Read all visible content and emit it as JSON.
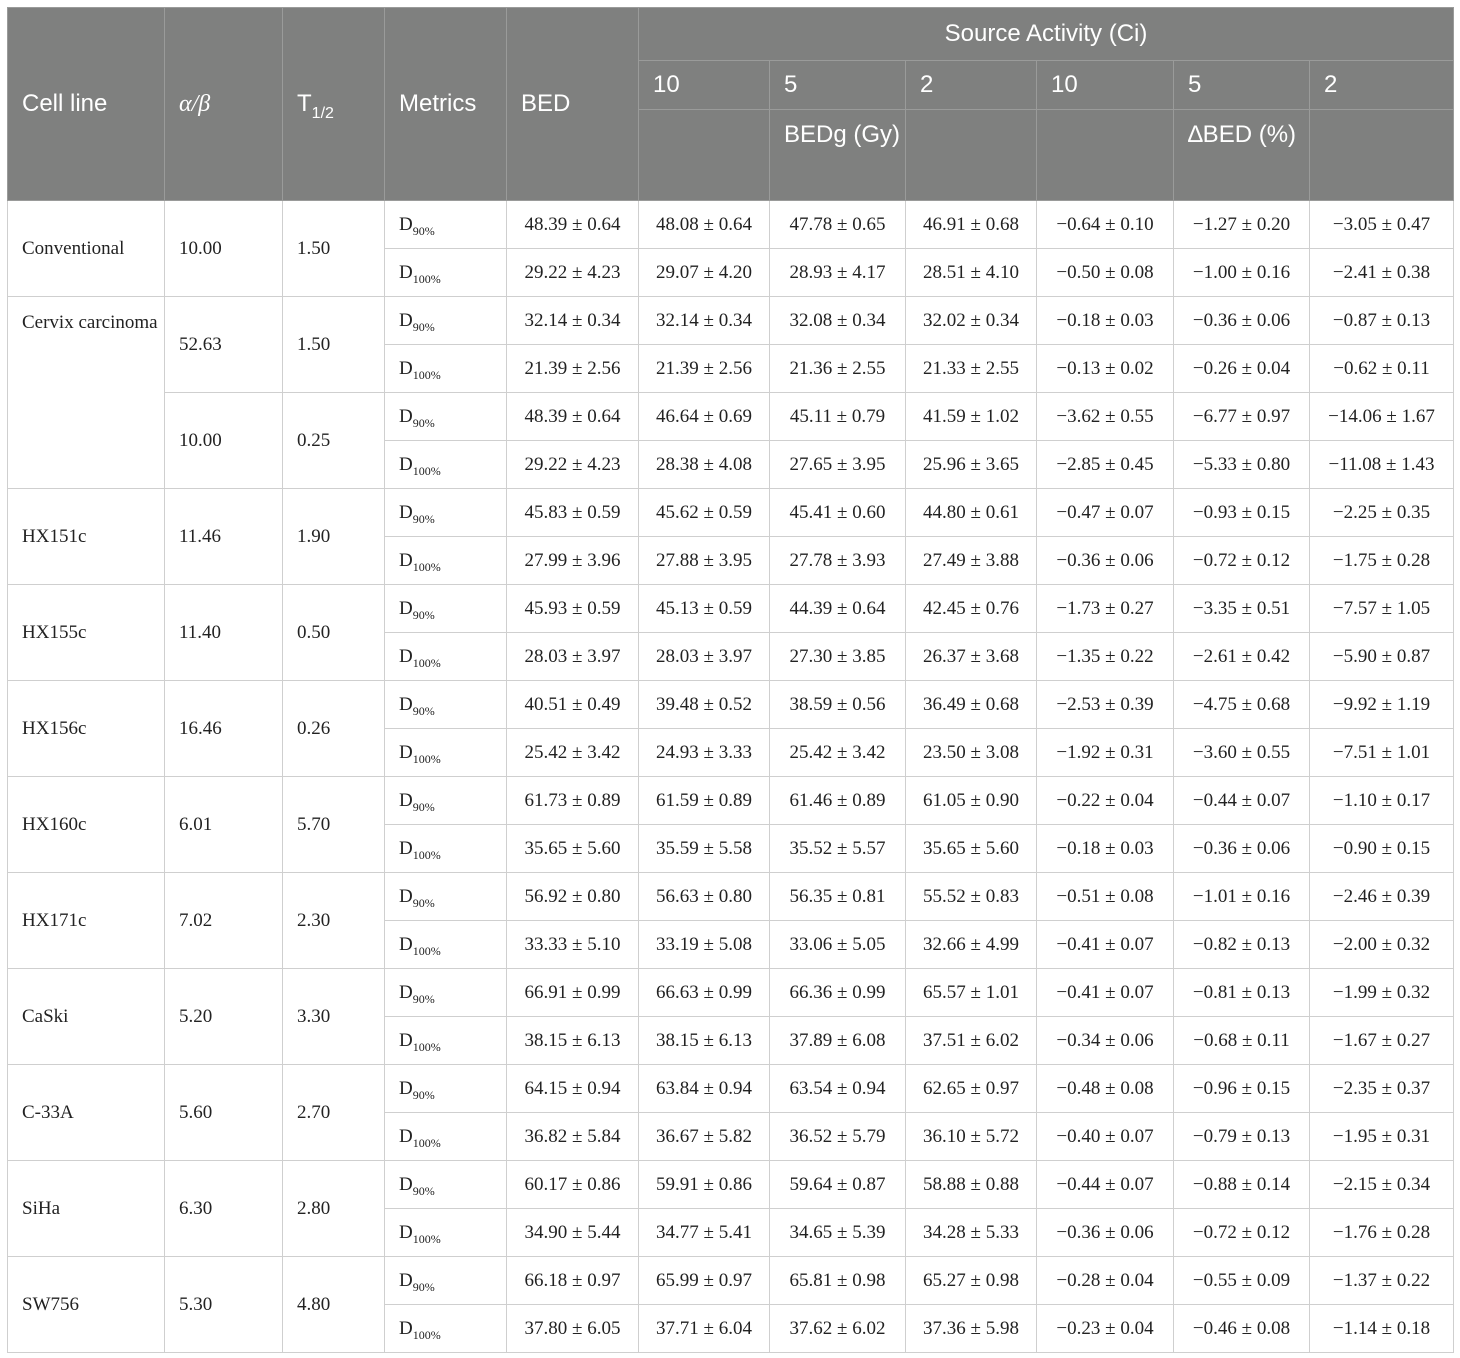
{
  "header": {
    "cell_line": "Cell line",
    "alpha_beta": "α/β",
    "t_half_main": "T",
    "t_half_sub": "1/2",
    "metrics": "Metrics",
    "bed": "BED",
    "source_activity": "Source Activity (Ci)",
    "activities": [
      "10",
      "5",
      "2",
      "10",
      "5",
      "2"
    ],
    "bedg": "BEDg (Gy)",
    "delta_bed": "∆BED (%)"
  },
  "metric_labels": {
    "d90_main": "D",
    "d90_sub": "90%",
    "d100_main": "D",
    "d100_sub": "100%"
  },
  "rows": [
    {
      "cell_line": "Conventional",
      "alpha_beta": "10.00",
      "t_half": "1.50",
      "d90": [
        "48.39 ± 0.64",
        "48.08 ± 0.64",
        "47.78 ± 0.65",
        "46.91 ± 0.68",
        "−0.64 ± 0.10",
        "−1.27 ± 0.20",
        "−3.05 ± 0.47"
      ],
      "d100": [
        "29.22 ± 4.23",
        "29.07 ± 4.20",
        "28.93 ± 4.17",
        "28.51 ± 4.10",
        "−0.50 ± 0.08",
        "−1.00 ± 0.16",
        "−2.41 ± 0.38"
      ]
    },
    {
      "cell_line": "Cervix carcinoma",
      "alpha_beta": "52.63",
      "t_half": "1.50",
      "d90": [
        "32.14 ± 0.34",
        "32.14 ± 0.34",
        "32.08 ± 0.34",
        "32.02 ± 0.34",
        "−0.18 ± 0.03",
        "−0.36 ± 0.06",
        "−0.87 ± 0.13"
      ],
      "d100": [
        "21.39 ± 2.56",
        "21.39 ± 2.56",
        "21.36 ± 2.55",
        "21.33 ± 2.55",
        "−0.13 ± 0.02",
        "−0.26 ± 0.04",
        "−0.62 ± 0.11"
      ]
    },
    {
      "cell_line": "",
      "alpha_beta": "10.00",
      "t_half": "0.25",
      "d90": [
        "48.39 ± 0.64",
        "46.64 ± 0.69",
        "45.11 ± 0.79",
        "41.59 ± 1.02",
        "−3.62 ± 0.55",
        "−6.77 ± 0.97",
        "−14.06 ± 1.67"
      ],
      "d100": [
        "29.22 ± 4.23",
        "28.38 ± 4.08",
        "27.65 ± 3.95",
        "25.96 ± 3.65",
        "−2.85 ± 0.45",
        "−5.33 ± 0.80",
        "−11.08 ± 1.43"
      ]
    },
    {
      "cell_line": "HX151c",
      "alpha_beta": "11.46",
      "t_half": "1.90",
      "d90": [
        "45.83 ± 0.59",
        "45.62 ± 0.59",
        "45.41 ± 0.60",
        "44.80 ± 0.61",
        "−0.47 ± 0.07",
        "−0.93 ± 0.15",
        "−2.25 ± 0.35"
      ],
      "d100": [
        "27.99 ± 3.96",
        "27.88 ± 3.95",
        "27.78 ± 3.93",
        "27.49 ± 3.88",
        "−0.36 ± 0.06",
        "−0.72 ± 0.12",
        "−1.75 ± 0.28"
      ]
    },
    {
      "cell_line": "HX155c",
      "alpha_beta": "11.40",
      "t_half": "0.50",
      "d90": [
        "45.93 ± 0.59",
        "45.13 ± 0.59",
        "44.39 ± 0.64",
        "42.45 ± 0.76",
        "−1.73 ± 0.27",
        "−3.35 ± 0.51",
        "−7.57 ± 1.05"
      ],
      "d100": [
        "28.03 ± 3.97",
        "28.03 ± 3.97",
        "27.30 ± 3.85",
        "26.37 ± 3.68",
        "−1.35 ± 0.22",
        "−2.61 ± 0.42",
        "−5.90 ± 0.87"
      ]
    },
    {
      "cell_line": "HX156c",
      "alpha_beta": "16.46",
      "t_half": "0.26",
      "d90": [
        "40.51 ± 0.49",
        "39.48 ± 0.52",
        "38.59 ± 0.56",
        "36.49 ± 0.68",
        "−2.53 ± 0.39",
        "−4.75 ± 0.68",
        "−9.92 ± 1.19"
      ],
      "d100": [
        "25.42 ± 3.42",
        "24.93 ± 3.33",
        "25.42 ± 3.42",
        "23.50 ± 3.08",
        "−1.92 ± 0.31",
        "−3.60 ± 0.55",
        "−7.51 ± 1.01"
      ]
    },
    {
      "cell_line": "HX160c",
      "alpha_beta": "6.01",
      "t_half": "5.70",
      "d90": [
        "61.73 ± 0.89",
        "61.59 ± 0.89",
        "61.46 ± 0.89",
        "61.05 ± 0.90",
        "−0.22 ± 0.04",
        "−0.44 ± 0.07",
        "−1.10 ± 0.17"
      ],
      "d100": [
        "35.65 ± 5.60",
        "35.59 ± 5.58",
        "35.52 ± 5.57",
        "35.65 ± 5.60",
        "−0.18 ± 0.03",
        "−0.36 ± 0.06",
        "−0.90 ± 0.15"
      ]
    },
    {
      "cell_line": "HX171c",
      "alpha_beta": "7.02",
      "t_half": "2.30",
      "d90": [
        "56.92 ± 0.80",
        "56.63 ± 0.80",
        "56.35 ± 0.81",
        "55.52 ± 0.83",
        "−0.51 ± 0.08",
        "−1.01 ± 0.16",
        "−2.46 ± 0.39"
      ],
      "d100": [
        "33.33 ± 5.10",
        "33.19 ± 5.08",
        "33.06 ± 5.05",
        "32.66 ± 4.99",
        "−0.41 ± 0.07",
        "−0.82 ± 0.13",
        "−2.00 ± 0.32"
      ]
    },
    {
      "cell_line": "CaSki",
      "alpha_beta": "5.20",
      "t_half": "3.30",
      "d90": [
        "66.91 ± 0.99",
        "66.63 ± 0.99",
        "66.36 ± 0.99",
        "65.57 ± 1.01",
        "−0.41 ± 0.07",
        "−0.81 ± 0.13",
        "−1.99 ± 0.32"
      ],
      "d100": [
        "38.15 ± 6.13",
        "38.15 ± 6.13",
        "37.89 ± 6.08",
        "37.51 ± 6.02",
        "−0.34 ± 0.06",
        "−0.68 ± 0.11",
        "−1.67 ± 0.27"
      ]
    },
    {
      "cell_line": "C-33A",
      "alpha_beta": "5.60",
      "t_half": "2.70",
      "d90": [
        "64.15 ± 0.94",
        "63.84 ± 0.94",
        "63.54 ± 0.94",
        "62.65 ± 0.97",
        "−0.48 ± 0.08",
        "−0.96 ± 0.15",
        "−2.35 ± 0.37"
      ],
      "d100": [
        "36.82 ± 5.84",
        "36.67 ± 5.82",
        "36.52 ± 5.79",
        "36.10 ± 5.72",
        "−0.40 ± 0.07",
        "−0.79 ± 0.13",
        "−1.95 ± 0.31"
      ]
    },
    {
      "cell_line": "SiHa",
      "alpha_beta": "6.30",
      "t_half": "2.80",
      "d90": [
        "60.17 ± 0.86",
        "59.91 ± 0.86",
        "59.64 ± 0.87",
        "58.88 ± 0.88",
        "−0.44 ± 0.07",
        "−0.88 ± 0.14",
        "−2.15 ± 0.34"
      ],
      "d100": [
        "34.90 ± 5.44",
        "34.77 ± 5.41",
        "34.65 ± 5.39",
        "34.28 ± 5.33",
        "−0.36 ± 0.06",
        "−0.72 ± 0.12",
        "−1.76 ± 0.28"
      ]
    },
    {
      "cell_line": "SW756",
      "alpha_beta": "5.30",
      "t_half": "4.80",
      "d90": [
        "66.18 ± 0.97",
        "65.99 ± 0.97",
        "65.81 ± 0.98",
        "65.27 ± 0.98",
        "−0.28 ± 0.04",
        "−0.55 ± 0.09",
        "−1.37 ± 0.22"
      ],
      "d100": [
        "37.80 ± 6.05",
        "37.71 ± 6.04",
        "37.62 ± 6.02",
        "37.36 ± 5.98",
        "−0.23 ± 0.04",
        "−0.46 ± 0.08",
        "−1.14 ± 0.18"
      ]
    }
  ]
}
